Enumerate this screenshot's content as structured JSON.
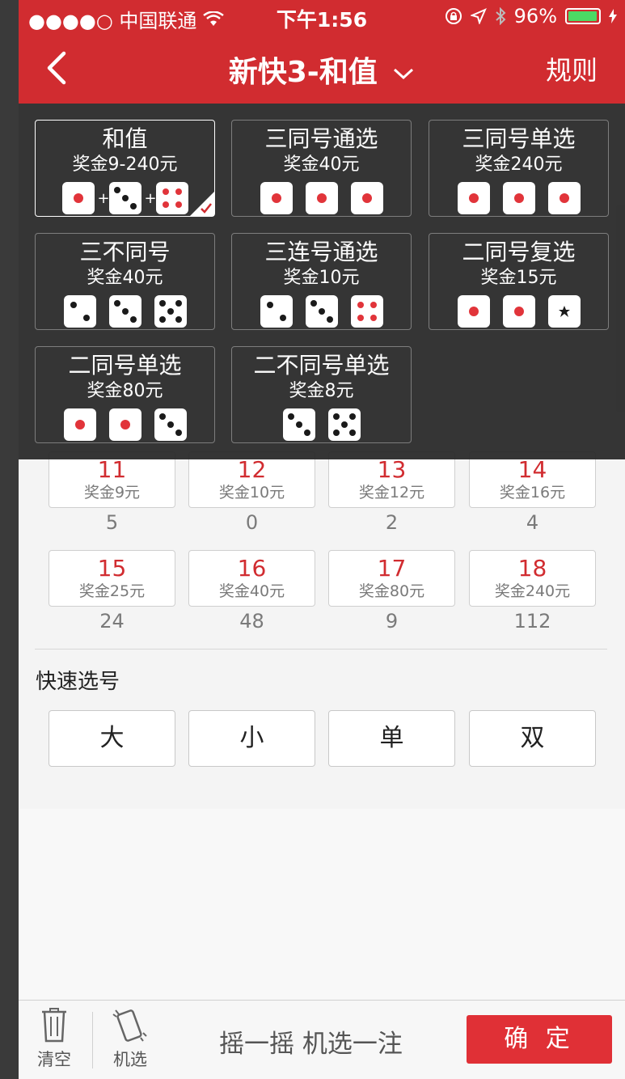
{
  "status_bar": {
    "carrier": "●●●●○ 中国联通",
    "time": "下午1:56",
    "battery": "96%",
    "battery_level": 0.96
  },
  "nav": {
    "title": "新快3-和值",
    "rules": "规则"
  },
  "play_types": [
    {
      "name": "和值",
      "prize": "奖金9-240元",
      "selected": true
    },
    {
      "name": "三同号通选",
      "prize": "奖金40元"
    },
    {
      "name": "三同号单选",
      "prize": "奖金240元"
    },
    {
      "name": "三不同号",
      "prize": "奖金40元"
    },
    {
      "name": "三连号通选",
      "prize": "奖金10元"
    },
    {
      "name": "二同号复选",
      "prize": "奖金15元"
    },
    {
      "name": "二同号单选",
      "prize": "奖金80元"
    },
    {
      "name": "二不同号单选",
      "prize": "奖金8元"
    }
  ],
  "sum_numbers": [
    {
      "num": "11",
      "prize": "奖金9元",
      "miss": "5"
    },
    {
      "num": "12",
      "prize": "奖金10元",
      "miss": "0"
    },
    {
      "num": "13",
      "prize": "奖金12元",
      "miss": "2"
    },
    {
      "num": "14",
      "prize": "奖金16元",
      "miss": "4"
    },
    {
      "num": "15",
      "prize": "奖金25元",
      "miss": "24"
    },
    {
      "num": "16",
      "prize": "奖金40元",
      "miss": "48"
    },
    {
      "num": "17",
      "prize": "奖金80元",
      "miss": "9"
    },
    {
      "num": "18",
      "prize": "奖金240元",
      "miss": "112"
    }
  ],
  "quick_select": {
    "title": "快速选号",
    "options": [
      "大",
      "小",
      "单",
      "双"
    ]
  },
  "bottom": {
    "clear": "清空",
    "random": "机选",
    "shake": "摇一摇 机选一注",
    "confirm": "确 定"
  },
  "colors": {
    "brand_red": "#d12c30",
    "overlay_bg": "#282828",
    "card_border": "#7d7d7d",
    "card_text": "#fefefe"
  }
}
